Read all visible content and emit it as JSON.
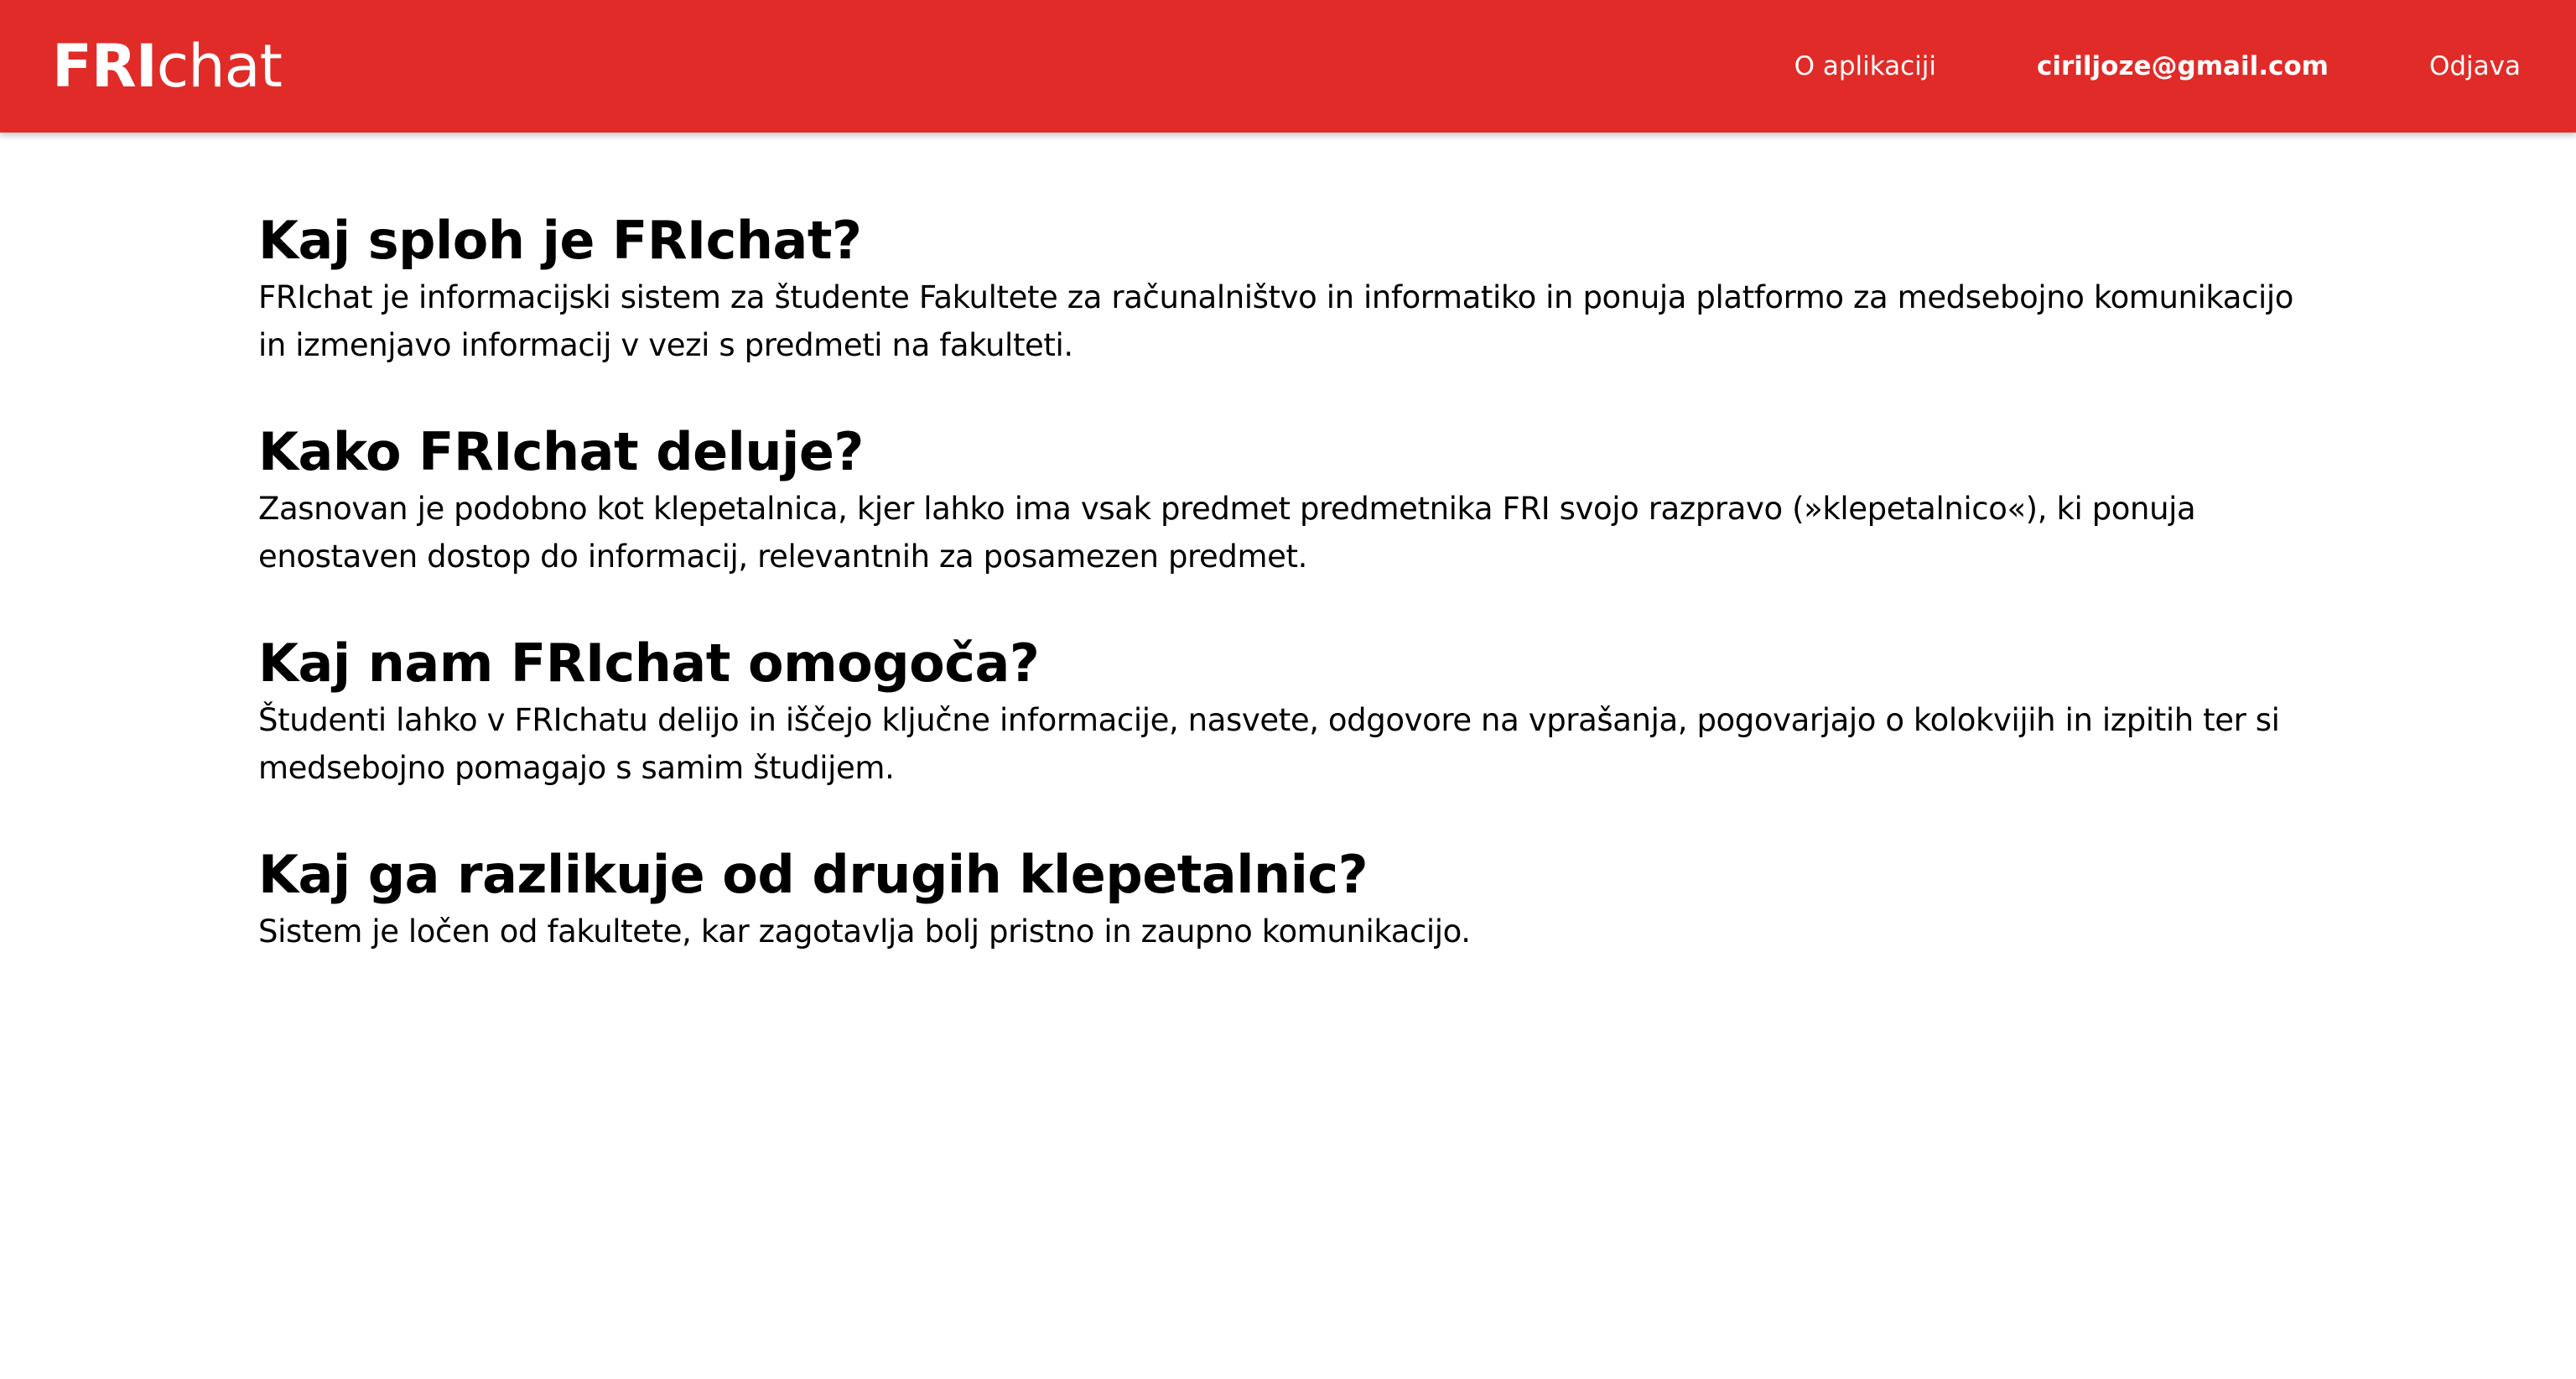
{
  "navbar": {
    "brand_bold": "FRI",
    "brand_light": "chat",
    "about_label": "O aplikaciji",
    "user_email": "ciriljoze@gmail.com",
    "logout_label": "Odjava",
    "color": "#e12b28"
  },
  "sections": [
    {
      "title": "Kaj sploh je FRIchat?",
      "text": "FRIchat je informacijski sistem za študente Fakultete za računalništvo in informatiko in ponuja platformo za medsebojno komunikacijo in izmenjavo informacij v vezi s predmeti na fakulteti."
    },
    {
      "title": "Kako FRIchat deluje?",
      "text": "Zasnovan je podobno kot klepetalnica, kjer lahko ima vsak predmet predmetnika FRI svojo razpravo (»klepetalnico«), ki ponuja enostaven dostop do informacij, relevantnih za posamezen predmet."
    },
    {
      "title": "Kaj nam FRIchat omogoča?",
      "text": "Študenti lahko v FRIchatu delijo in iščejo ključne informacije, nasvete, odgovore na vprašanja, pogovarjajo o kolokvijih in izpitih ter si medsebojno pomagajo s samim študijem."
    },
    {
      "title": "Kaj ga razlikuje od drugih klepetalnic?",
      "text": "Sistem je ločen od fakultete, kar zagotavlja bolj pristno in zaupno komunikacijo."
    }
  ]
}
